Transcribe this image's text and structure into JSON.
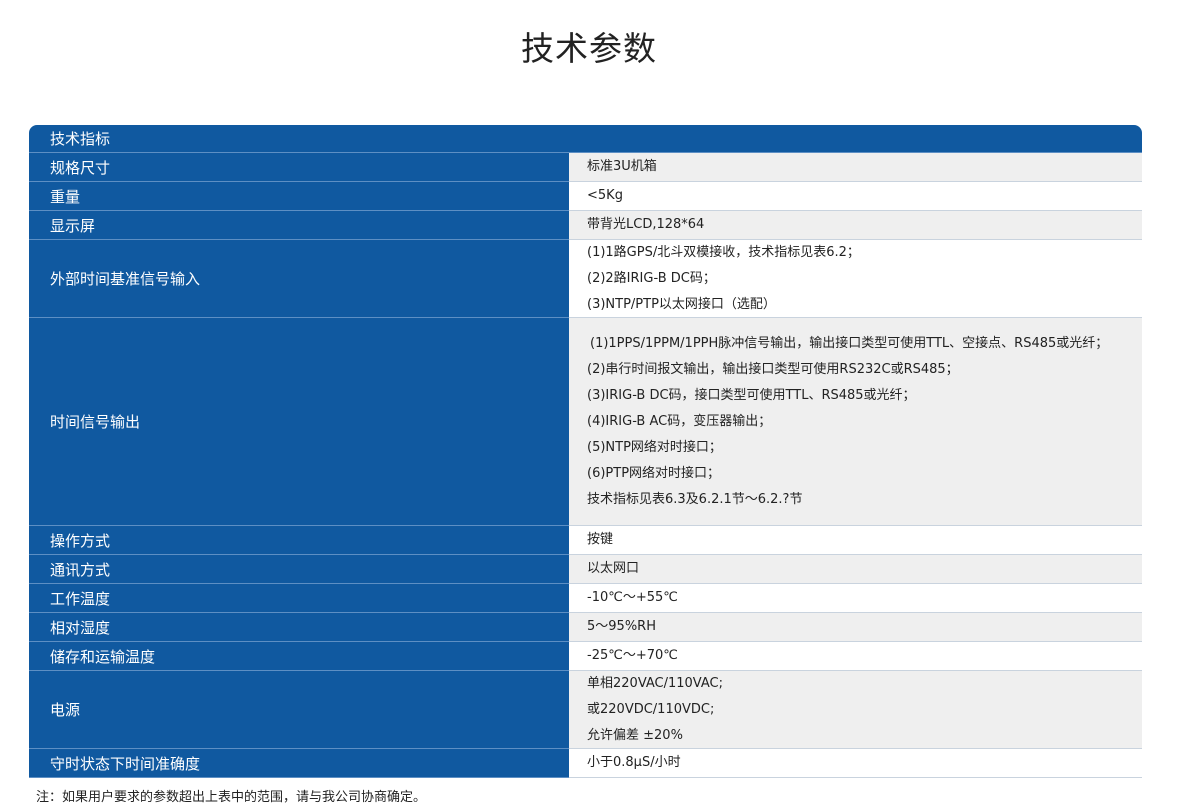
{
  "title": "技术参数",
  "table": {
    "header": "技术指标",
    "rows": [
      {
        "key": "规格尺寸",
        "values": [
          "标准3U机箱"
        ]
      },
      {
        "key": "重量",
        "values": [
          "<5Kg"
        ]
      },
      {
        "key": "显示屏",
        "values": [
          "带背光LCD,128*64"
        ]
      },
      {
        "key": "外部时间基准信号输入",
        "values": [
          "(1)1路GPS/北斗双模接收，技术指标见表6.2；",
          "(2)2路IRIG-B DC码；",
          "(3)NTP/PTP以太网接口（选配）"
        ]
      },
      {
        "key": "时间信号输出",
        "values": [
          "(1)1PPS/1PPM/1PPH脉冲信号输出，输出接口类型可使用TTL、空接点、RS485或光纤；",
          "(2)串行时间报文输出，输出接口类型可使用RS232C或RS485；",
          "(3)IRIG-B DC码，接口类型可使用TTL、RS485或光纤；",
          "(4)IRIG-B AC码，变压器输出；",
          "(5)NTP网络对时接口；",
          "(6)PTP网络对时接口；",
          "技术指标见表6.3及6.2.1节～6.2.?节"
        ]
      },
      {
        "key": "操作方式",
        "values": [
          "按键"
        ]
      },
      {
        "key": "通讯方式",
        "values": [
          "以太网口"
        ]
      },
      {
        "key": "工作温度",
        "values": [
          "-10℃～+55℃"
        ]
      },
      {
        "key": "相对湿度",
        "values": [
          "5～95%RH"
        ]
      },
      {
        "key": "储存和运输温度",
        "values": [
          "-25℃～+70℃"
        ]
      },
      {
        "key": "电源",
        "values": [
          "单相220VAC/110VAC;",
          "或220VDC/110VDC;",
          "允许偏差 ±20%"
        ]
      },
      {
        "key": "守时状态下时间准确度",
        "values": [
          "小于0.8μS/小时"
        ]
      }
    ]
  },
  "note": "注：如果用户要求的参数超出上表中的范围，请与我公司协商确定。"
}
